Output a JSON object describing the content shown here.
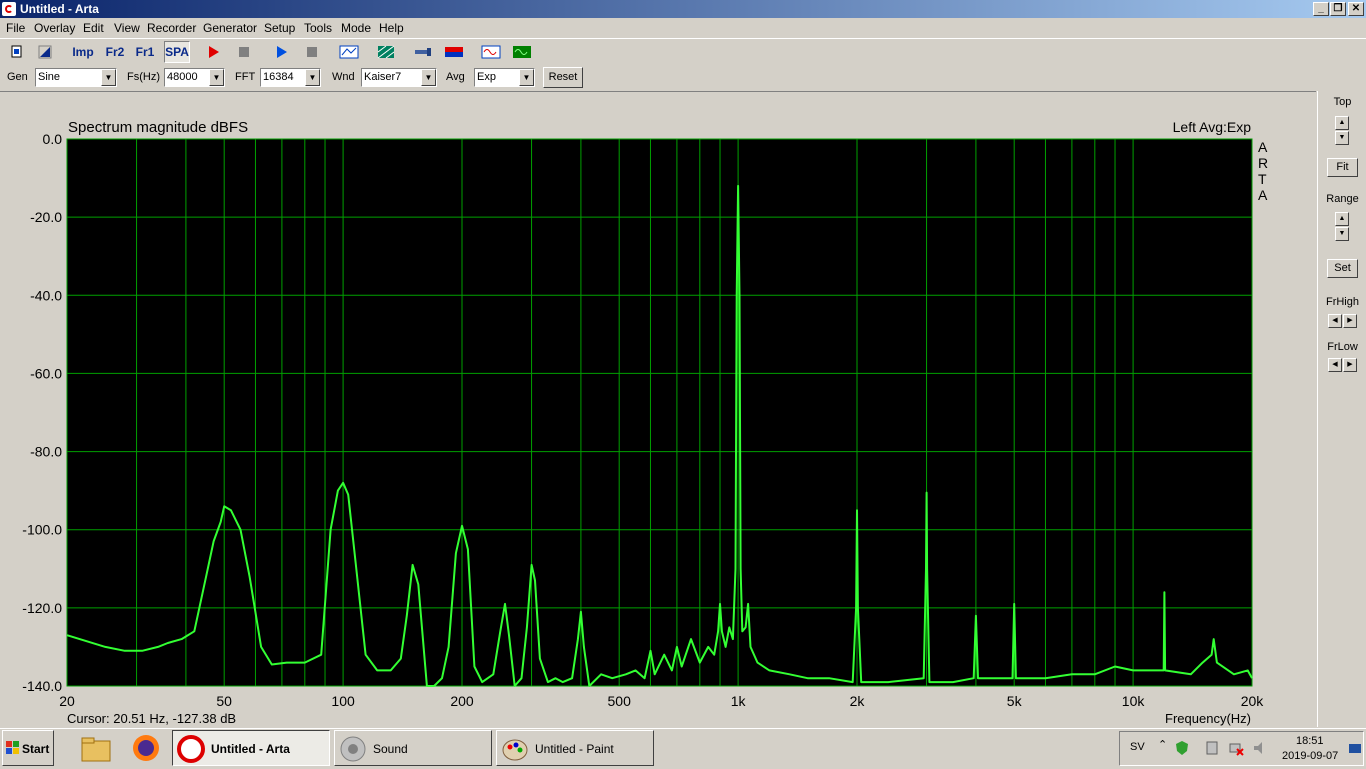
{
  "window": {
    "title": "Untitled - Arta",
    "min": "_",
    "max": "❐",
    "close": "✕"
  },
  "menu": [
    "File",
    "Overlay",
    "Edit",
    "View",
    "Recorder",
    "Generator",
    "Setup",
    "Tools",
    "Mode",
    "Help"
  ],
  "toolbar": {
    "imp": "Imp",
    "fr2": "Fr2",
    "fr1": "Fr1",
    "spa": "SPA",
    "icons": [
      "new-document-icon",
      "open-icon",
      "record-icon",
      "stop-icon",
      "play-icon",
      "stop-icon",
      "abc-icon",
      "pattern-icon",
      "probe-icon",
      "color-bars-icon",
      "sine-generator-icon",
      "oscilloscope-icon"
    ]
  },
  "params": {
    "gen_label": "Gen",
    "gen": "Sine",
    "fs_label": "Fs(Hz)",
    "fs": "48000",
    "fft_label": "FFT",
    "fft": "16384",
    "wnd_label": "Wnd",
    "wnd": "Kaiser7",
    "avg_label": "Avg",
    "avg": "Exp",
    "reset": "Reset"
  },
  "graph": {
    "title": "Spectrum magnitude dBFS",
    "channel_info": "Left  Avg:Exp",
    "watermark": [
      "A",
      "R",
      "T",
      "A"
    ],
    "cursor": "Cursor: 20.51 Hz, -127.38 dB",
    "xlabel": "Frequency(Hz)",
    "colors": {
      "background": "#000000",
      "grid": "#00a000",
      "trace": "#33ff33"
    }
  },
  "chart_data": {
    "type": "line",
    "title": "Spectrum magnitude dBFS",
    "xlabel": "Frequency(Hz)",
    "ylabel": "",
    "x_scale": "log",
    "xlim": [
      20,
      20000
    ],
    "ylim": [
      -140,
      0
    ],
    "x_ticks": [
      {
        "v": 20,
        "l": "20"
      },
      {
        "v": 50,
        "l": "50"
      },
      {
        "v": 100,
        "l": "100"
      },
      {
        "v": 200,
        "l": "200"
      },
      {
        "v": 500,
        "l": "500"
      },
      {
        "v": 1000,
        "l": "1k"
      },
      {
        "v": 2000,
        "l": "2k"
      },
      {
        "v": 5000,
        "l": "5k"
      },
      {
        "v": 10000,
        "l": "10k"
      },
      {
        "v": 20000,
        "l": "20k"
      }
    ],
    "y_ticks": [
      {
        "v": 0,
        "l": "0.0"
      },
      {
        "v": -20,
        "l": "-20.0"
      },
      {
        "v": -40,
        "l": "-40.0"
      },
      {
        "v": -60,
        "l": "-60.0"
      },
      {
        "v": -80,
        "l": "-80.0"
      },
      {
        "v": -100,
        "l": "-100.0"
      },
      {
        "v": -120,
        "l": "-120.0"
      },
      {
        "v": -140,
        "l": "-140.0"
      }
    ],
    "grid": true,
    "series": [
      {
        "points": [
          [
            20,
            -127
          ],
          [
            25,
            -130
          ],
          [
            28,
            -131
          ],
          [
            31,
            -131
          ],
          [
            34,
            -130
          ],
          [
            36,
            -129
          ],
          [
            39,
            -128
          ],
          [
            42,
            -126
          ],
          [
            45,
            -112
          ],
          [
            47,
            -103
          ],
          [
            49,
            -98
          ],
          [
            50,
            -94
          ],
          [
            52,
            -95
          ],
          [
            55,
            -100
          ],
          [
            58,
            -112
          ],
          [
            62,
            -130
          ],
          [
            66,
            -134.5
          ],
          [
            72,
            -134
          ],
          [
            80,
            -134
          ],
          [
            88,
            -132
          ],
          [
            93,
            -100
          ],
          [
            97,
            -90
          ],
          [
            100,
            -88
          ],
          [
            103,
            -91
          ],
          [
            108,
            -110
          ],
          [
            114,
            -132
          ],
          [
            122,
            -136
          ],
          [
            132,
            -136
          ],
          [
            140,
            -133
          ],
          [
            145,
            -122
          ],
          [
            150,
            -109
          ],
          [
            155,
            -114
          ],
          [
            163,
            -140
          ],
          [
            170,
            -140
          ],
          [
            178,
            -138
          ],
          [
            185,
            -130
          ],
          [
            193,
            -106
          ],
          [
            200,
            -99
          ],
          [
            207,
            -105
          ],
          [
            215,
            -135
          ],
          [
            225,
            -139
          ],
          [
            240,
            -137
          ],
          [
            250,
            -126
          ],
          [
            257,
            -119
          ],
          [
            263,
            -127
          ],
          [
            272,
            -140
          ],
          [
            283,
            -138
          ],
          [
            292,
            -125
          ],
          [
            300,
            -109
          ],
          [
            306,
            -113
          ],
          [
            315,
            -133
          ],
          [
            330,
            -139
          ],
          [
            345,
            -138
          ],
          [
            360,
            -139
          ],
          [
            380,
            -138
          ],
          [
            393,
            -128
          ],
          [
            400,
            -121
          ],
          [
            407,
            -130
          ],
          [
            420,
            -140
          ],
          [
            450,
            -137
          ],
          [
            480,
            -138
          ],
          [
            520,
            -137
          ],
          [
            550,
            -136
          ],
          [
            580,
            -138
          ],
          [
            600,
            -131
          ],
          [
            615,
            -137
          ],
          [
            650,
            -132
          ],
          [
            680,
            -136
          ],
          [
            700,
            -130
          ],
          [
            720,
            -135
          ],
          [
            760,
            -128
          ],
          [
            800,
            -134
          ],
          [
            840,
            -130
          ],
          [
            870,
            -132
          ],
          [
            890,
            -126
          ],
          [
            900,
            -119
          ],
          [
            910,
            -126
          ],
          [
            930,
            -130
          ],
          [
            950,
            -125
          ],
          [
            970,
            -128
          ],
          [
            985,
            -110
          ],
          [
            992,
            -40
          ],
          [
            1000,
            -12
          ],
          [
            1008,
            -40
          ],
          [
            1015,
            -110
          ],
          [
            1025,
            -126
          ],
          [
            1045,
            -125
          ],
          [
            1060,
            -119
          ],
          [
            1075,
            -130
          ],
          [
            1120,
            -134
          ],
          [
            1200,
            -136
          ],
          [
            1350,
            -137
          ],
          [
            1500,
            -138
          ],
          [
            1700,
            -138
          ],
          [
            1950,
            -139
          ],
          [
            1990,
            -120
          ],
          [
            2000,
            -95
          ],
          [
            2010,
            -120
          ],
          [
            2050,
            -139
          ],
          [
            2400,
            -139
          ],
          [
            2950,
            -138
          ],
          [
            2990,
            -110
          ],
          [
            3000,
            -90.5
          ],
          [
            3010,
            -110
          ],
          [
            3050,
            -139
          ],
          [
            3500,
            -139
          ],
          [
            3950,
            -138
          ],
          [
            4000,
            -122
          ],
          [
            4050,
            -138
          ],
          [
            4950,
            -138
          ],
          [
            5000,
            -119
          ],
          [
            5050,
            -138
          ],
          [
            6000,
            -138
          ],
          [
            7000,
            -137
          ],
          [
            8000,
            -137
          ],
          [
            9000,
            -135
          ],
          [
            10000,
            -136
          ],
          [
            11000,
            -136
          ],
          [
            11950,
            -136
          ],
          [
            12000,
            -116
          ],
          [
            12050,
            -136
          ],
          [
            14000,
            -137
          ],
          [
            15000,
            -134
          ],
          [
            15800,
            -132
          ],
          [
            16000,
            -128
          ],
          [
            16300,
            -134
          ],
          [
            18000,
            -137
          ],
          [
            19500,
            -136
          ],
          [
            20000,
            -138
          ]
        ]
      }
    ]
  },
  "right_panel": {
    "top_label": "Top",
    "fit": "Fit",
    "range_label": "Range",
    "set": "Set",
    "frhigh_label": "FrHigh",
    "frlow_label": "FrLow"
  },
  "taskbar": {
    "start": "Start",
    "tasks": [
      {
        "label": "Untitled - Arta",
        "icon": "arta-icon"
      },
      {
        "label": "Sound",
        "icon": "speaker-icon"
      },
      {
        "label": "Untitled - Paint",
        "icon": "paint-icon"
      }
    ],
    "lang": "SV",
    "time": "18:51",
    "date": "2019-09-07"
  }
}
